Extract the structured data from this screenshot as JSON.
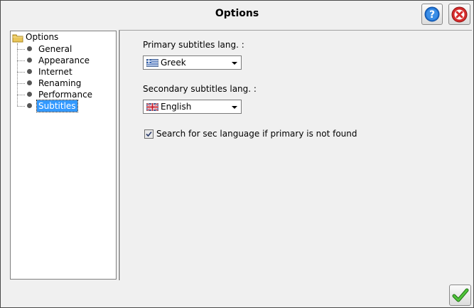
{
  "window": {
    "title": "Options"
  },
  "tree": {
    "root": "Options",
    "items": [
      {
        "label": "General",
        "selected": false
      },
      {
        "label": "Appearance",
        "selected": false
      },
      {
        "label": "Internet",
        "selected": false
      },
      {
        "label": "Renaming",
        "selected": false
      },
      {
        "label": "Performance",
        "selected": false
      },
      {
        "label": "Subtitles",
        "selected": true
      }
    ]
  },
  "subtitles": {
    "primary_label": "Primary subtitles lang. :",
    "primary_value": "Greek",
    "primary_flag": "greece-flag-icon",
    "secondary_label": "Secondary subtitles lang. :",
    "secondary_value": "English",
    "secondary_flag": "uk-flag-icon",
    "checkbox_label": "Search for sec language if primary is not found",
    "checkbox_checked": true
  },
  "icons": {
    "help": "help-icon",
    "close": "close-icon",
    "ok": "checkmark-icon"
  },
  "colors": {
    "selection": "#3399ff",
    "help_blue": "#1e6fd0",
    "close_red": "#d42a2a",
    "ok_green": "#3aa826"
  }
}
